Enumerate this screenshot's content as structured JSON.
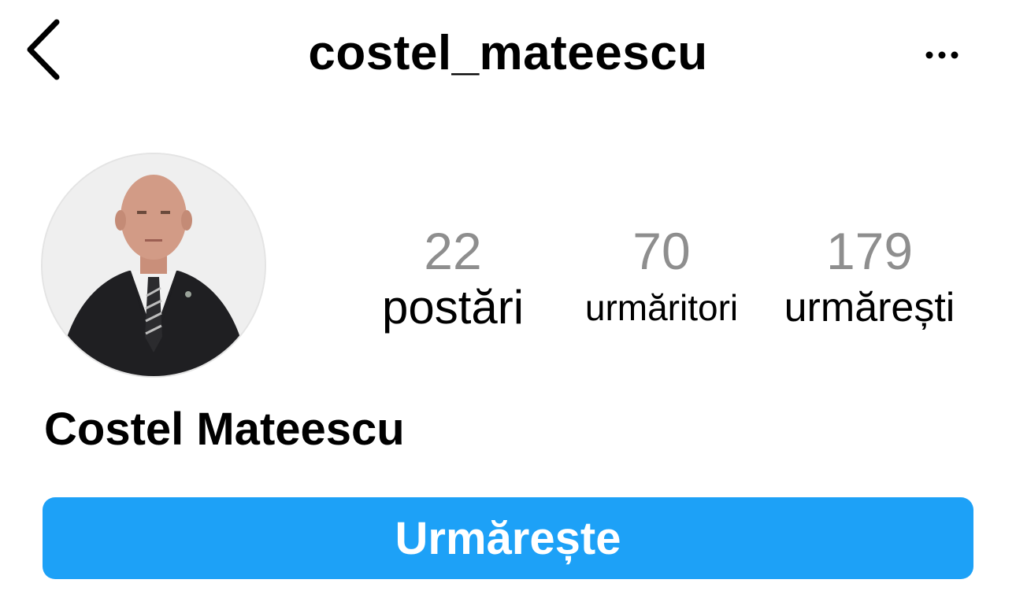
{
  "header": {
    "username": "costel_mateescu",
    "back_icon": "chevron-left-icon",
    "more_icon": "more-horizontal-icon"
  },
  "profile": {
    "avatar": "profile-photo",
    "full_name": "Costel Mateescu",
    "stats": {
      "posts": {
        "count": "22",
        "label": "postări"
      },
      "followers": {
        "count": "70",
        "label": "urmăritori"
      },
      "following": {
        "count": "179",
        "label": "urmărești"
      }
    }
  },
  "actions": {
    "follow_label": "Urmărește"
  },
  "colors": {
    "accent": "#1da1f7",
    "stat_number": "#8e8e8e",
    "text": "#000000",
    "background": "#ffffff"
  }
}
